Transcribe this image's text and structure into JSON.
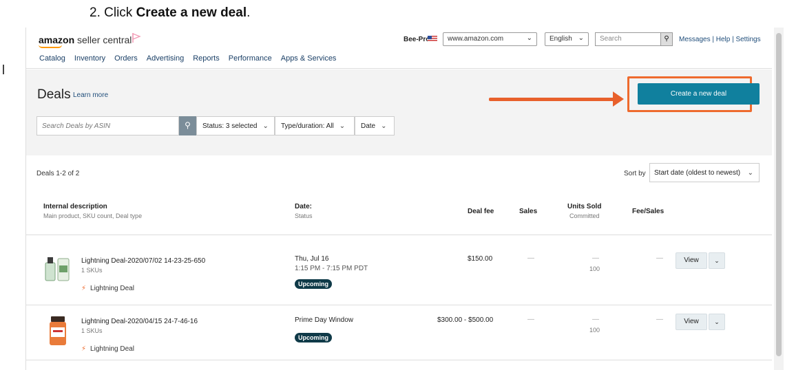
{
  "instruction": {
    "prefix": "2.  Click ",
    "bold": "Create a new deal",
    "suffix": "."
  },
  "header": {
    "brand": "amazon",
    "brand_sub": " seller central",
    "account": "Bee-Pro",
    "marketplace": "www.amazon.com",
    "language": "English",
    "search_placeholder": "Search",
    "links": "Messages | Help | Settings",
    "nav": [
      "Catalog",
      "Inventory",
      "Orders",
      "Advertising",
      "Reports",
      "Performance",
      "Apps & Services"
    ]
  },
  "deals": {
    "title": "Deals",
    "learn_more": "Learn more",
    "search_placeholder": "Search Deals by ASIN",
    "filters": {
      "status": "Status: 3 selected",
      "type": "Type/duration: All",
      "date": "Date"
    },
    "create_button": "Create a new deal"
  },
  "results": {
    "count": "Deals 1-2 of 2",
    "sort_label": "Sort by",
    "sort_value": "Start date (oldest to newest)",
    "columns": {
      "internal": "Internal description",
      "internal_sub": "Main product, SKU count, Deal type",
      "date": "Date:",
      "date_sub": "Status",
      "fee": "Deal fee",
      "sales": "Sales",
      "units": "Units Sold",
      "units_sub": "Committed",
      "fee_sales": "Fee/Sales"
    },
    "rows": [
      {
        "name": "Lightning Deal-2020/07/02 14-23-25-650",
        "skus": "1 SKUs",
        "type": "Lightning Deal",
        "date": "Thu, Jul 16",
        "time": "1:15 PM - 7:15 PM PDT",
        "status": "Upcoming",
        "fee": "$150.00",
        "sales": "—",
        "units_sold": "—",
        "committed": "100",
        "fee_sales": "—",
        "view": "View"
      },
      {
        "name": "Lightning Deal-2020/04/15 24-7-46-16",
        "skus": "1 SKUs",
        "type": "Lightning Deal",
        "date": "Prime Day Window",
        "time": "",
        "status": "Upcoming",
        "fee": "$300.00 - $500.00",
        "sales": "—",
        "units_sold": "—",
        "committed": "100",
        "fee_sales": "—",
        "view": "View"
      }
    ]
  },
  "colors": {
    "accent": "#10809e",
    "highlight": "#ee6a2d",
    "badge": "#0f3a48",
    "link": "#1f4d7a"
  }
}
